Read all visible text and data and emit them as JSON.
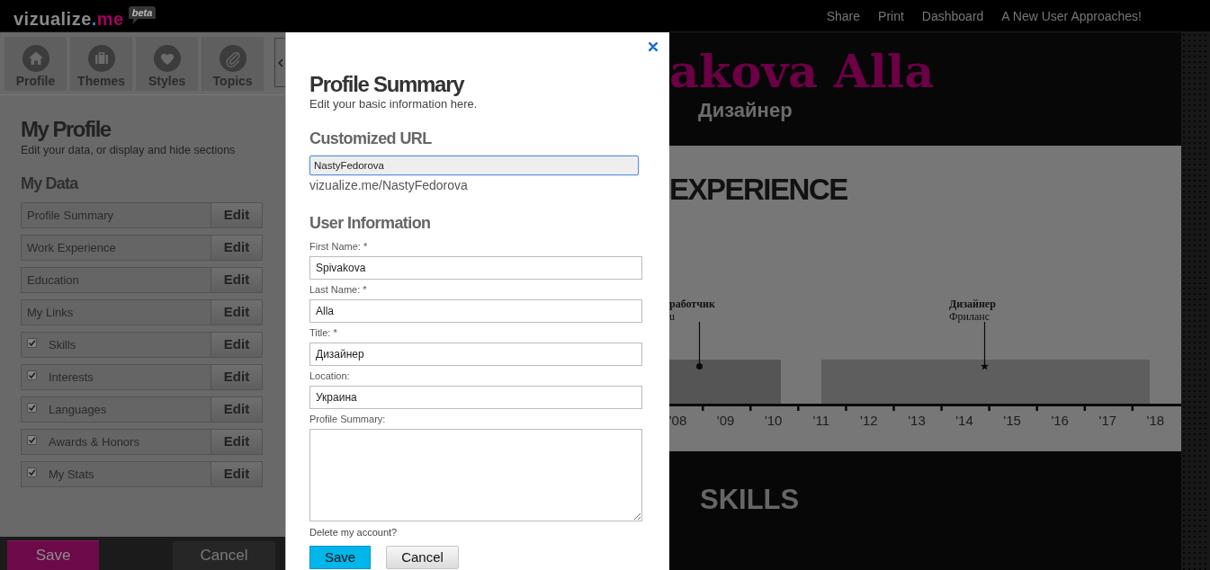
{
  "top_bar": {
    "logo": {
      "parts": [
        {
          "text": "vizualize",
          "kind": "base"
        },
        {
          "text": ".",
          "kind": "dot"
        },
        {
          "text": "me",
          "kind": "accent"
        }
      ],
      "badge": "beta"
    },
    "nav": [
      "Share",
      "Print",
      "Dashboard",
      "A New User Approaches!"
    ]
  },
  "sidebar": {
    "tabs": [
      {
        "label": "Profile"
      },
      {
        "label": "Themes"
      },
      {
        "label": "Styles"
      },
      {
        "label": "Topics"
      }
    ],
    "title": "My Profile",
    "subtitle": "Edit your data, or display and hide sections",
    "section_title": "My Data",
    "items": [
      {
        "label": "Profile Summary",
        "kind": "plain",
        "action": "Edit"
      },
      {
        "label": "Work Experience",
        "kind": "plain",
        "action": "Edit"
      },
      {
        "label": "Education",
        "kind": "plain",
        "action": "Edit"
      },
      {
        "label": "My Links",
        "kind": "plain",
        "action": "Edit"
      },
      {
        "label": "Skills",
        "kind": "toggle",
        "checked": true,
        "action": "Edit"
      },
      {
        "label": "Interests",
        "kind": "toggle",
        "checked": true,
        "action": "Edit"
      },
      {
        "label": "Languages",
        "kind": "toggle",
        "checked": true,
        "action": "Edit"
      },
      {
        "label": "Awards & Honors",
        "kind": "toggle",
        "checked": true,
        "action": "Edit"
      },
      {
        "label": "My Stats",
        "kind": "toggle",
        "checked": true,
        "action": "Edit"
      }
    ],
    "footer_buttons": [
      {
        "label": "Save",
        "kind": "primary"
      },
      {
        "label": "Cancel",
        "kind": "secondary"
      }
    ]
  },
  "dialog": {
    "title": "Profile Summary",
    "subtitle": "Edit your basic information here.",
    "url_section": {
      "heading": "Customized URL",
      "value": "NastyFedorova",
      "focused": true,
      "preview": "vizualize.me/NastyFedorova"
    },
    "user_section": {
      "heading": "User Information",
      "fields": [
        {
          "label": "First Name: *",
          "kind": "input",
          "value": "Spivakova"
        },
        {
          "label": "Last Name: *",
          "kind": "input",
          "value": "Alla"
        },
        {
          "label": "Title: *",
          "kind": "input",
          "value": "Дизайнер"
        },
        {
          "label": "Location:",
          "kind": "input",
          "value": "Украина"
        },
        {
          "label": "Profile Summary:",
          "kind": "textarea"
        }
      ]
    },
    "delete_link": "Delete my account?",
    "buttons": [
      {
        "label": "Save",
        "kind": "primary"
      },
      {
        "label": "Cancel",
        "kind": "secondary"
      }
    ]
  },
  "resume": {
    "name": "akova Alla",
    "title": "Дизайнер",
    "experience": {
      "heading": "EXPERIENCE",
      "entries": [
        {
          "title": "работчик",
          "subtitle": "u",
          "kind": "dot"
        },
        {
          "title": "Дизайнер",
          "subtitle": "Фриланс",
          "kind": "star"
        }
      ],
      "ticks": [
        "'08",
        "'09",
        "'10",
        "'11",
        "'12",
        "'13",
        "'14",
        "'15",
        "'16",
        "'17",
        "'18"
      ]
    },
    "skills": {
      "heading": "SKILLS"
    }
  }
}
